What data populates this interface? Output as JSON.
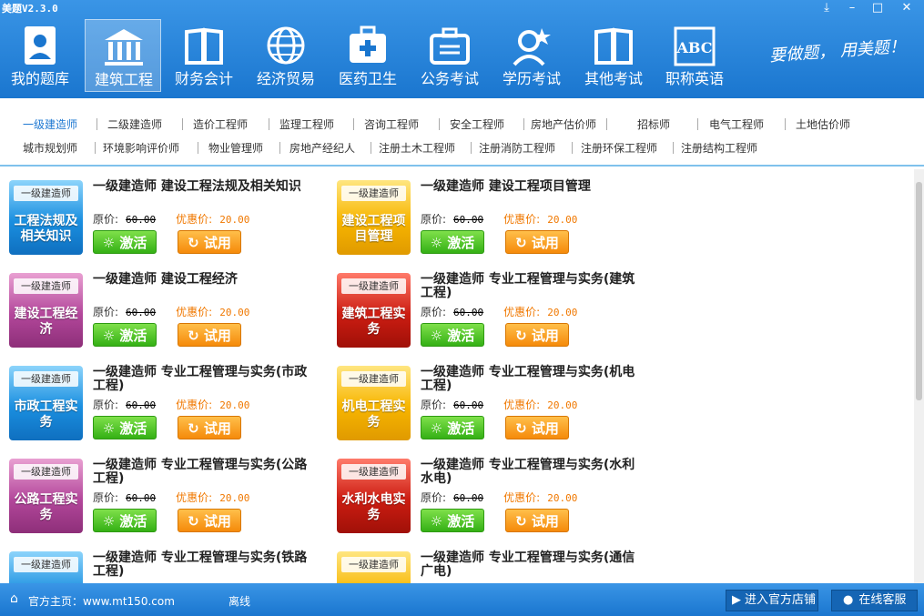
{
  "app": {
    "title": "美题V2.3.0"
  },
  "window": {
    "download": "⤓",
    "minimize": "–",
    "maximize": "□",
    "close": "✕"
  },
  "categories": [
    {
      "label": "我的题库",
      "icon": "question-bank-icon"
    },
    {
      "label": "建筑工程",
      "icon": "building-icon"
    },
    {
      "label": "财务会计",
      "icon": "book-icon"
    },
    {
      "label": "经济贸易",
      "icon": "globe-icon"
    },
    {
      "label": "医药卫生",
      "icon": "medical-kit-icon"
    },
    {
      "label": "公务考试",
      "icon": "briefcase-icon"
    },
    {
      "label": "学历考试",
      "icon": "graduate-icon"
    },
    {
      "label": "其他考试",
      "icon": "book-icon"
    },
    {
      "label": "职称英语",
      "icon": "abc-icon"
    }
  ],
  "slogan": "要做题， 用美题！",
  "tabs_row1": [
    "一级建造师",
    "二级建造师",
    "造价工程师",
    "监理工程师",
    "咨询工程师",
    "安全工程师",
    "房地产估价师",
    "招标师",
    "电气工程师",
    "土地估价师"
  ],
  "tabs_row2": [
    "城市规划师",
    "环境影响评价师",
    "物业管理师",
    "房地产经纪人",
    "注册土木工程师",
    "注册消防工程师",
    "注册环保工程师",
    "注册结构工程师"
  ],
  "price": {
    "original_label": "原价:",
    "original_value": "60.00",
    "discount_label": "优惠价:",
    "discount_value": "20.00"
  },
  "buttons": {
    "activate": "激活",
    "trial": "试用"
  },
  "products": [
    {
      "badge": "一级建造师",
      "cover": "工程法规及相关知识",
      "title": "一级建造师  建设工程法规及相关知识",
      "color": "blue"
    },
    {
      "badge": "一级建造师",
      "cover": "建设工程项目管理",
      "title": "一级建造师  建设工程项目管理",
      "color": "yellow"
    },
    {
      "badge": "一级建造师",
      "cover": "建设工程经济",
      "title": "一级建造师  建设工程经济",
      "color": "pink"
    },
    {
      "badge": "一级建造师",
      "cover": "建筑工程实务",
      "title": "一级建造师  专业工程管理与实务(建筑工程)",
      "color": "red"
    },
    {
      "badge": "一级建造师",
      "cover": "市政工程实务",
      "title": "一级建造师  专业工程管理与实务(市政工程)",
      "color": "blue"
    },
    {
      "badge": "一级建造师",
      "cover": "机电工程实务",
      "title": "一级建造师  专业工程管理与实务(机电工程)",
      "color": "yellow"
    },
    {
      "badge": "一级建造师",
      "cover": "公路工程实务",
      "title": "一级建造师  专业工程管理与实务(公路工程)",
      "color": "pink"
    },
    {
      "badge": "一级建造师",
      "cover": "水利水电实务",
      "title": "一级建造师  专业工程管理与实务(水利水电)",
      "color": "red"
    },
    {
      "badge": "一级建造师",
      "cover": "",
      "title": "一级建造师  专业工程管理与实务(铁路工程)",
      "color": "blue"
    },
    {
      "badge": "一级建造师",
      "cover": "",
      "title": "一级建造师  专业工程管理与实务(通信广电)",
      "color": "yellow"
    }
  ],
  "footer": {
    "home_label": "官方主页：www.mt150.com",
    "status": "离线",
    "store": "进入官方店铺",
    "service": "在线客服"
  }
}
